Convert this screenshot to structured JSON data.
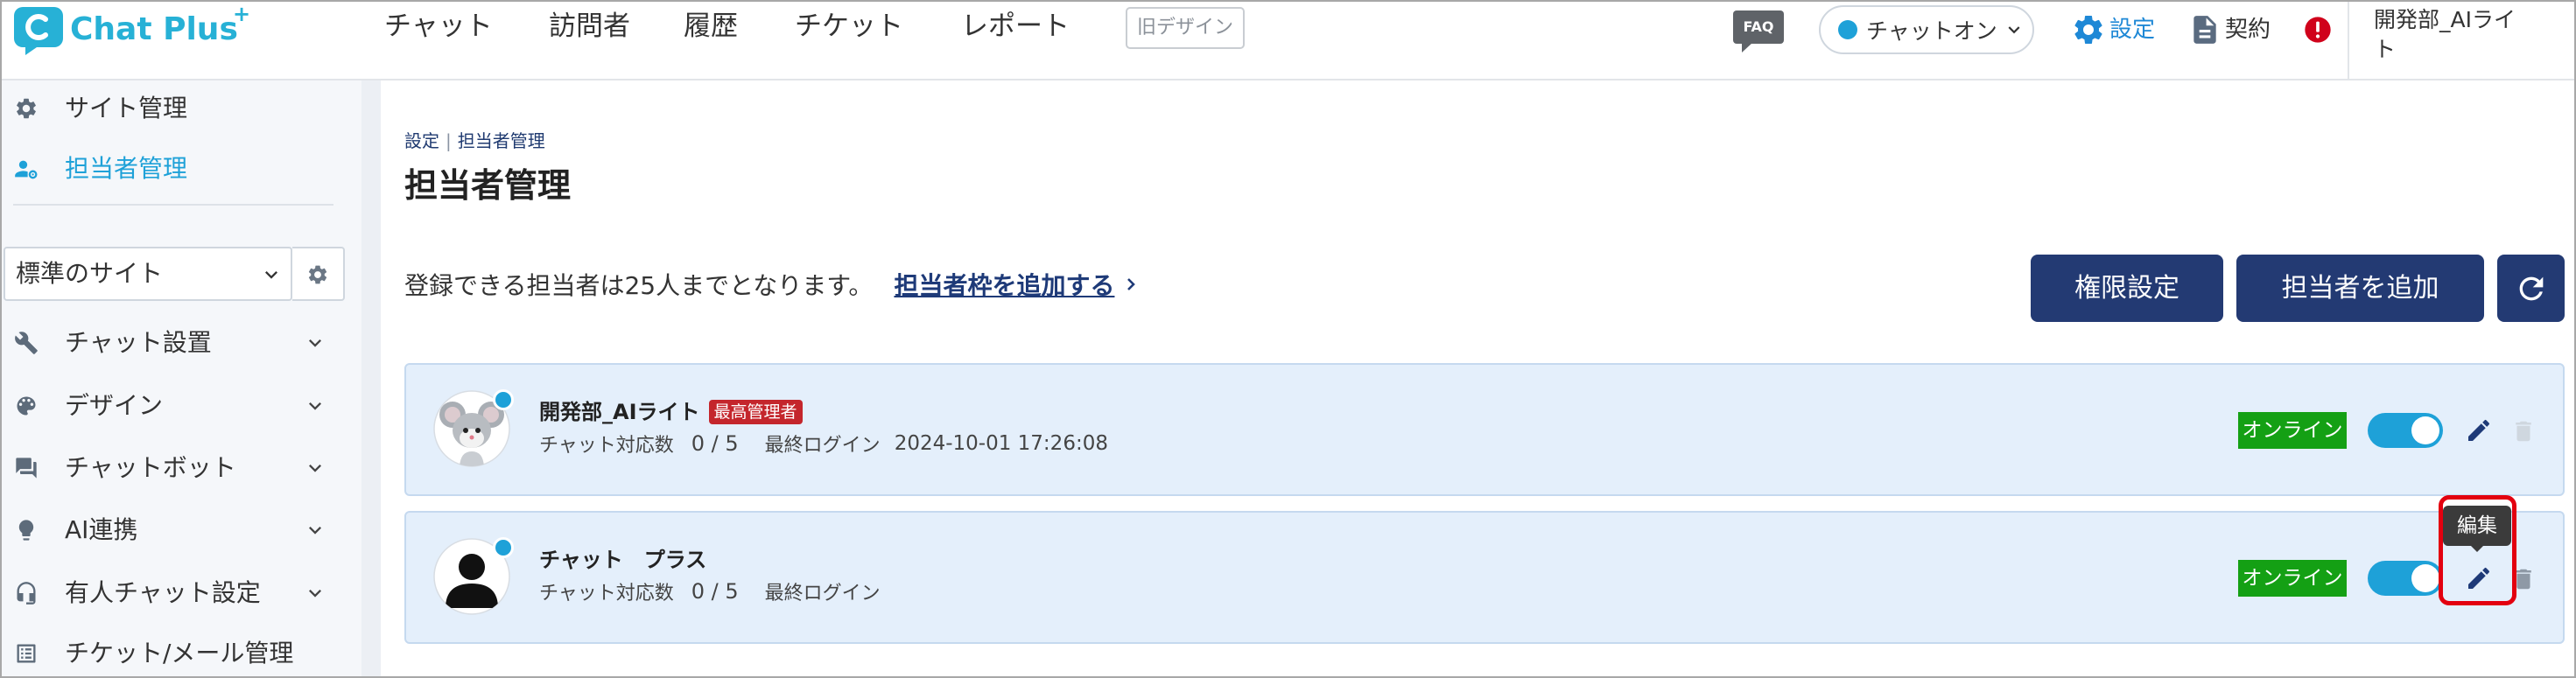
{
  "colors": {
    "brand": "#27b1d6",
    "accent": "#1ea1d8",
    "navy": "#233a73",
    "link": "#1e3a78",
    "online": "#14a014",
    "danger": "#c4262c",
    "highlight": "#e3000f",
    "card_bg": "#e4effb",
    "card_border": "#c5d9ef"
  },
  "header": {
    "logo": {
      "text": "Chat Plus",
      "sup": "+"
    },
    "nav": [
      "チャット",
      "訪問者",
      "履歴",
      "チケット",
      "レポート"
    ],
    "old_design": "旧デザイン",
    "faq": "FAQ",
    "chat_status": "チャットオン",
    "settings": "設定",
    "contract": "契約",
    "user_name": "開発部_AIライト"
  },
  "sidebar": {
    "top": [
      {
        "label": "サイト管理",
        "icon": "site-settings-icon"
      },
      {
        "label": "担当者管理",
        "icon": "agent-settings-icon",
        "active": true
      }
    ],
    "site_select": {
      "value": "標準のサイト"
    },
    "menu": [
      {
        "label": "チャット設置",
        "icon": "tools-icon"
      },
      {
        "label": "デザイン",
        "icon": "palette-icon"
      },
      {
        "label": "チャットボット",
        "icon": "chatbot-icon"
      },
      {
        "label": "AI連携",
        "icon": "ai-icon"
      },
      {
        "label": "有人チャット設定",
        "icon": "headset-icon"
      },
      {
        "label": "チケット/メール管理",
        "icon": "ticket-icon"
      }
    ]
  },
  "main": {
    "breadcrumb": {
      "parent": "設定",
      "separator": "|",
      "current": "担当者管理"
    },
    "title": "担当者管理",
    "limit_text": "登録できる担当者は25人までとなります。",
    "add_slot_link": "担当者枠を追加する",
    "buttons": {
      "permissions": "権限設定",
      "add_agent": "担当者を追加"
    },
    "agents": [
      {
        "name": "開発部_AIライト",
        "role_badge": "最高管理者",
        "chat_label": "チャット対応数",
        "chat_count": "0 / 5",
        "last_login_label": "最終ログイン",
        "last_login": "2024-10-01 17:26:08",
        "status": "オンライン",
        "enabled": true,
        "online": true,
        "avatar": "mouse-avatar",
        "delete_enabled": false
      },
      {
        "name": "チャット　プラス",
        "chat_label": "チャット対応数",
        "chat_count": "0 / 5",
        "last_login_label": "最終ログイン",
        "status": "オンライン",
        "enabled": true,
        "online": true,
        "avatar": "silhouette-avatar",
        "delete_enabled": true
      }
    ],
    "tooltip": "編集"
  }
}
